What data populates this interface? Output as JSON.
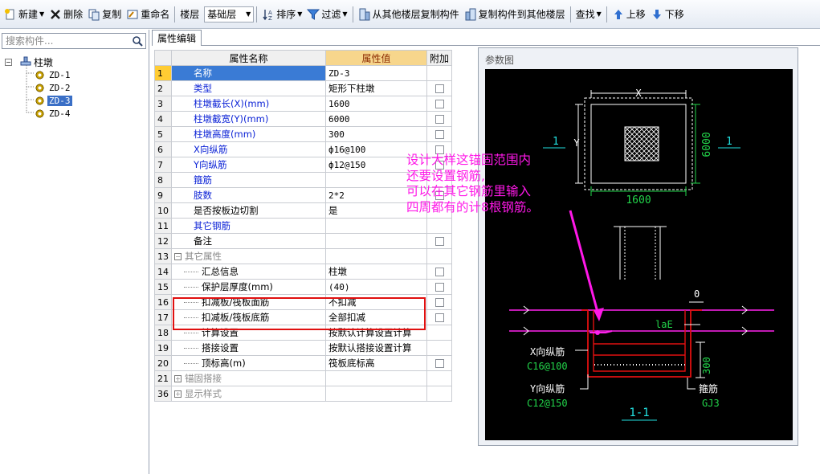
{
  "toolbar": {
    "new_label": "新建",
    "delete_label": "删除",
    "copy_label": "复制",
    "rename_label": "重命名",
    "floor_label": "楼层",
    "floor_value": "基础层",
    "sort_label": "排序",
    "filter_label": "过滤",
    "copy_from_floor_label": "从其他楼层复制构件",
    "copy_to_floor_label": "复制构件到其他楼层",
    "find_label": "查找",
    "move_up_label": "上移",
    "move_down_label": "下移"
  },
  "search": {
    "placeholder": "搜索构件..."
  },
  "tree": {
    "root_label": "柱墩",
    "items": [
      "ZD-1",
      "ZD-2",
      "ZD-3",
      "ZD-4"
    ],
    "selected": "ZD-3"
  },
  "tabs": {
    "property_edit": "属性编辑"
  },
  "grid": {
    "headers": {
      "name": "属性名称",
      "value": "属性值",
      "extra": "附加"
    },
    "rows": [
      {
        "num": "1",
        "name": "名称",
        "value": "ZD-3"
      },
      {
        "num": "2",
        "name": "类型",
        "value": "矩形下柱墩"
      },
      {
        "num": "3",
        "name": "柱墩截长(X)(mm)",
        "value": "1600"
      },
      {
        "num": "4",
        "name": "柱墩截宽(Y)(mm)",
        "value": "6000"
      },
      {
        "num": "5",
        "name": "柱墩高度(mm)",
        "value": "300"
      },
      {
        "num": "6",
        "name": "X向纵筋",
        "value": "ф16@100"
      },
      {
        "num": "7",
        "name": "Y向纵筋",
        "value": "ф12@150"
      },
      {
        "num": "8",
        "name": "箍筋",
        "value": ""
      },
      {
        "num": "9",
        "name": "肢数",
        "value": "2*2"
      },
      {
        "num": "10",
        "name": "是否按板边切割",
        "value": "是"
      },
      {
        "num": "11",
        "name": "其它钢筋",
        "value": ""
      },
      {
        "num": "12",
        "name": "备注",
        "value": ""
      },
      {
        "num": "13",
        "name": "其它属性",
        "value": ""
      },
      {
        "num": "14",
        "name": "汇总信息",
        "value": "柱墩"
      },
      {
        "num": "15",
        "name": "保护层厚度(mm)",
        "value": "(40)"
      },
      {
        "num": "16",
        "name": "扣减板/筏板面筋",
        "value": "不扣减"
      },
      {
        "num": "17",
        "name": "扣减板/筏板底筋",
        "value": "全部扣减"
      },
      {
        "num": "18",
        "name": "计算设置",
        "value": "按默认计算设置计算"
      },
      {
        "num": "19",
        "name": "搭接设置",
        "value": "按默认搭接设置计算"
      },
      {
        "num": "20",
        "name": "顶标高(m)",
        "value": "筏板底标高"
      },
      {
        "num": "21",
        "name": "锚固搭接",
        "value": ""
      },
      {
        "num": "36",
        "name": "显示样式",
        "value": ""
      }
    ]
  },
  "param_panel": {
    "title": "参数图",
    "labels": {
      "x": "X",
      "y": "Y",
      "width": "1600",
      "height": "6000",
      "section_left": "1",
      "section_right": "1",
      "offset": "0",
      "anchor": "laE",
      "depth": "300",
      "x_bar_label": "X向纵筋",
      "x_bar_value": "C16@100",
      "y_bar_label": "Y向纵筋",
      "y_bar_value": "C12@150",
      "stirrup_label": "箍筋",
      "stirrup_value": "GJ3",
      "section_name": "1-1"
    }
  },
  "annotation": {
    "lines": [
      "设计大样这锚固范围内",
      "还要设置钢筋,",
      "可以在其它钢筋里输入",
      "四周都有的计8根钢筋。"
    ]
  },
  "colors": {
    "annotation": "#ff18e8",
    "highlight_box": "#e01010",
    "selected_row": "#3a7bd5",
    "header_value_bg": "#f7d68c",
    "property_blue": "#0b22d6"
  }
}
